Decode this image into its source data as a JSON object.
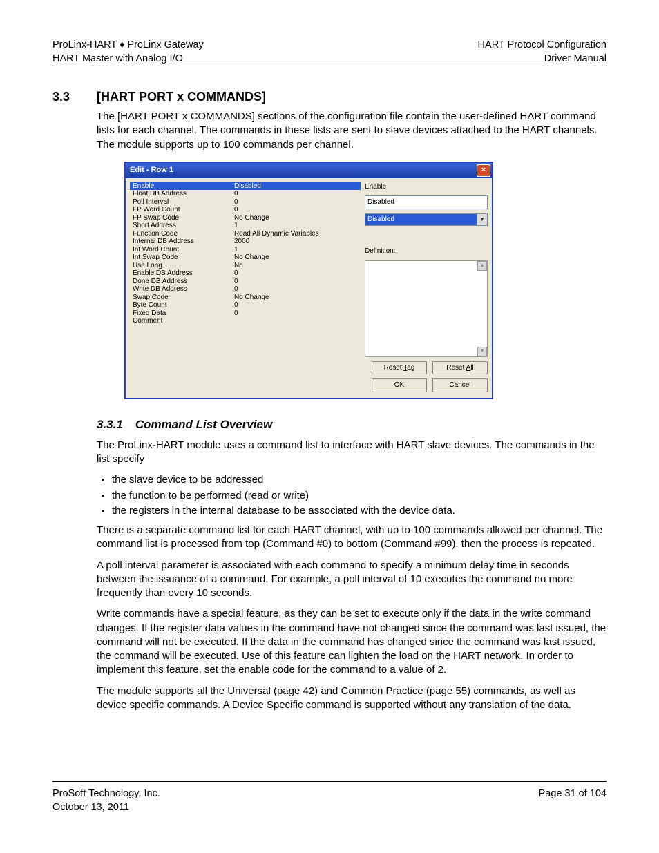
{
  "header": {
    "left1": "ProLinx-HART ♦ ProLinx Gateway",
    "left2": "HART Master with Analog I/O",
    "right1": "HART Protocol Configuration",
    "right2": "Driver Manual"
  },
  "section": {
    "number": "3.3",
    "title": "[HART PORT x COMMANDS]",
    "intro": "The [HART PORT x COMMANDS] sections of the configuration file contain the user-defined HART command lists for each channel. The commands in these lists are sent to slave devices attached to the HART channels. The module supports up to 100 commands per channel."
  },
  "dialog": {
    "title": "Edit - Row 1",
    "enable_label": "Enable",
    "enable_value": "Disabled",
    "dropdown_selected": "Disabled",
    "definition_label": "Definition:",
    "rows": [
      {
        "k": "Enable",
        "v": "Disabled",
        "sel": true
      },
      {
        "k": "Float DB Address",
        "v": "0"
      },
      {
        "k": "Poll Interval",
        "v": "0"
      },
      {
        "k": "FP Word Count",
        "v": "0"
      },
      {
        "k": "FP Swap Code",
        "v": "No Change"
      },
      {
        "k": "Short Address",
        "v": "1"
      },
      {
        "k": "Function Code",
        "v": "Read All Dynamic Variables"
      },
      {
        "k": "Internal DB Address",
        "v": "2000"
      },
      {
        "k": "Int Word Count",
        "v": "1"
      },
      {
        "k": "Int Swap Code",
        "v": "No Change"
      },
      {
        "k": "Use Long",
        "v": "No"
      },
      {
        "k": "Enable DB Address",
        "v": "0"
      },
      {
        "k": "Done DB Address",
        "v": "0"
      },
      {
        "k": "Write DB Address",
        "v": "0"
      },
      {
        "k": "Swap Code",
        "v": "No Change"
      },
      {
        "k": "Byte Count",
        "v": "0"
      },
      {
        "k": "Fixed Data",
        "v": "0"
      },
      {
        "k": "Comment",
        "v": ""
      }
    ],
    "buttons": {
      "reset_tag_pre": "Reset ",
      "reset_tag_accel": "T",
      "reset_tag_post": "ag",
      "reset_all_pre": "Reset ",
      "reset_all_accel": "A",
      "reset_all_post": "ll",
      "ok": "OK",
      "cancel": "Cancel"
    }
  },
  "subsection": {
    "number": "3.3.1",
    "title": "Command List Overview",
    "p1": "The ProLinx-HART  module uses a command list to interface with HART slave devices. The commands in the list specify",
    "bullets": [
      "the slave device to be addressed",
      "the function to be performed (read or write)",
      "the registers in the internal database to be associated with the device data."
    ],
    "p2": "There is a separate command list for each HART channel, with up to 100 commands allowed per channel. The command list is processed from top (Command #0) to bottom (Command #99), then the process is repeated.",
    "p3": "A poll interval parameter is associated with each command to specify a minimum delay time in seconds between the issuance of a command. For example, a poll interval of 10 executes the command no more frequently than every 10 seconds.",
    "p4": "Write commands have a special feature, as they can be set to execute only if the data in the write command changes. If the register data values in the command have not changed since the command was last issued, the command will not be executed. If the data in the command has changed since the command was last issued, the command will be executed. Use of this feature can lighten the load on the HART network. In order to implement this feature, set the enable code for the command to a value of 2.",
    "p5": "The module supports all the Universal (page 42) and Common Practice (page 55) commands, as well as device specific commands. A Device Specific command is supported without any translation of the data."
  },
  "footer": {
    "left1": "ProSoft Technology, Inc.",
    "left2": "October 13, 2011",
    "right1": "Page 31 of 104"
  }
}
